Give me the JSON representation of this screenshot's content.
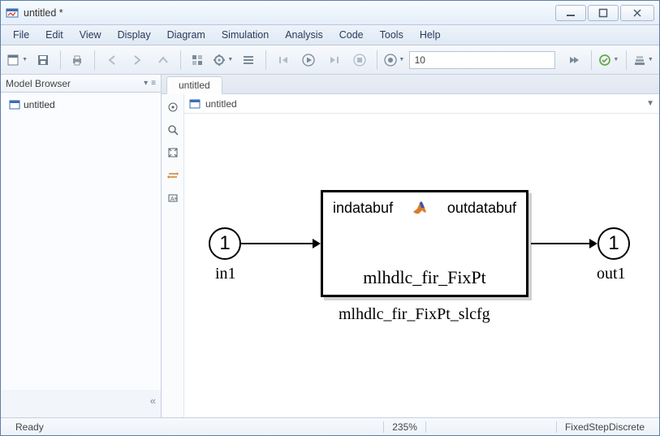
{
  "title": "untitled *",
  "menu": [
    "File",
    "Edit",
    "View",
    "Display",
    "Diagram",
    "Simulation",
    "Analysis",
    "Code",
    "Tools",
    "Help"
  ],
  "toolbar": {
    "time": "10"
  },
  "sidebar": {
    "header": "Model Browser",
    "items": [
      {
        "label": "untitled"
      }
    ]
  },
  "tabs": [
    {
      "label": "untitled"
    }
  ],
  "breadcrumb": {
    "label": "untitled"
  },
  "diagram": {
    "inport": {
      "num": "1",
      "label": "in1"
    },
    "outport": {
      "num": "1",
      "label": "out1"
    },
    "block": {
      "left_port": "indatabuf",
      "right_port": "outdatabuf",
      "function": "mlhdlc_fir_FixPt",
      "caption": "mlhdlc_fir_FixPt_slcfg"
    }
  },
  "status": {
    "ready": "Ready",
    "zoom": "235%",
    "solver": "FixedStepDiscrete"
  }
}
